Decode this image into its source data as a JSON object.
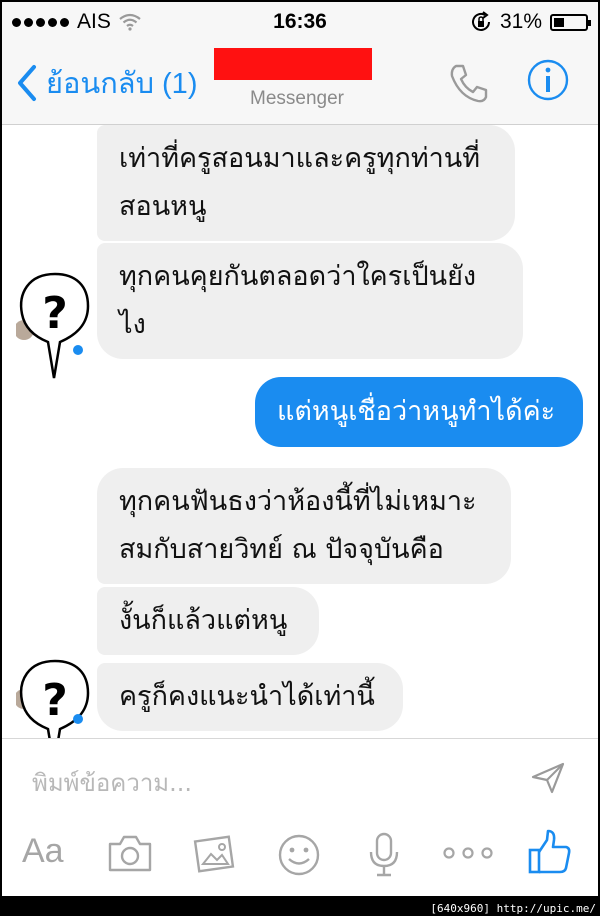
{
  "status_bar": {
    "carrier": "AIS",
    "time": "16:36",
    "battery": "31%",
    "icons": [
      "signal-dots-icon",
      "wifi-icon",
      "rotation-lock-icon",
      "battery-icon"
    ]
  },
  "nav": {
    "back_label": "ย้อนกลับ (1)",
    "subtitle": "Messenger",
    "icons": [
      "chevron-left-icon",
      "phone-icon",
      "info-icon"
    ]
  },
  "messages": [
    {
      "side": "received",
      "lines": [
        "เท่าที่ครูสอนมาและครูทุกท่านที่",
        "สอนหนู"
      ]
    },
    {
      "side": "received",
      "lines": [
        "ทุกคนคุยกันตลอดว่าใครเป็นยัง",
        "ไง"
      ]
    },
    {
      "side": "sent",
      "lines": [
        "แต่หนูเชื่อว่าหนูทำได้ค่ะ"
      ]
    },
    {
      "side": "received",
      "lines": [
        "ทุกคนฟันธงว่าห้องนี้ที่ไม่เหมาะ",
        "สมกับสายวิทย์ ณ ปัจจุบันคือ"
      ]
    },
    {
      "side": "received",
      "lines": [
        "งั้นก็แล้วแต่หนู"
      ]
    },
    {
      "side": "received",
      "lines": [
        "ครูก็คงแนะนำได้เท่านี้"
      ]
    }
  ],
  "avatar_glyph": "?",
  "composer": {
    "placeholder": "พิมพ์ข้อความ...",
    "send_icon": "send-icon"
  },
  "toolbar": {
    "text_label": "Aa",
    "icons": [
      "camera-icon",
      "gallery-icon",
      "emoji-icon",
      "microphone-icon",
      "more-icon",
      "like-icon"
    ]
  },
  "watermark": "[640x960] http://upic.me/",
  "colors": {
    "accent": "#1a8cf0",
    "received_bubble": "#efefef",
    "redaction": "#ff1111"
  }
}
